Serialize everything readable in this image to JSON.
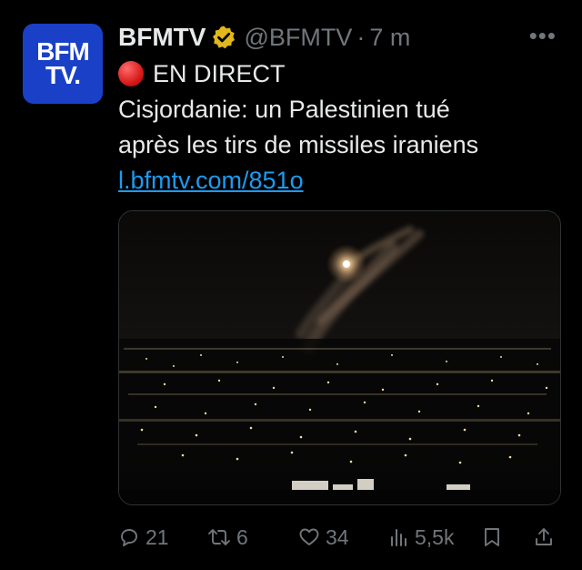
{
  "tweet": {
    "author": {
      "logo_line1": "BFM",
      "logo_line2": "TV.",
      "name": "BFMTV",
      "handle": "@BFMTV",
      "separator": "·",
      "time": "7 m"
    },
    "more_label": "•••",
    "body": {
      "live_label": "EN DIRECT",
      "line1": "Cisjordanie: un Palestinien tué",
      "line2": "après les tirs de missiles iraniens",
      "link": "l.bfmtv.com/851o"
    },
    "actions": {
      "replies": "21",
      "retweets": "6",
      "likes": "34",
      "views": "5,5k"
    },
    "colors": {
      "background": "#000000",
      "text": "#e7e9ea",
      "muted": "#71767b",
      "link": "#1d9bf0",
      "verified": "#e2b719",
      "avatar": "#1a40c8",
      "live_dot": "#d81b1b"
    }
  }
}
